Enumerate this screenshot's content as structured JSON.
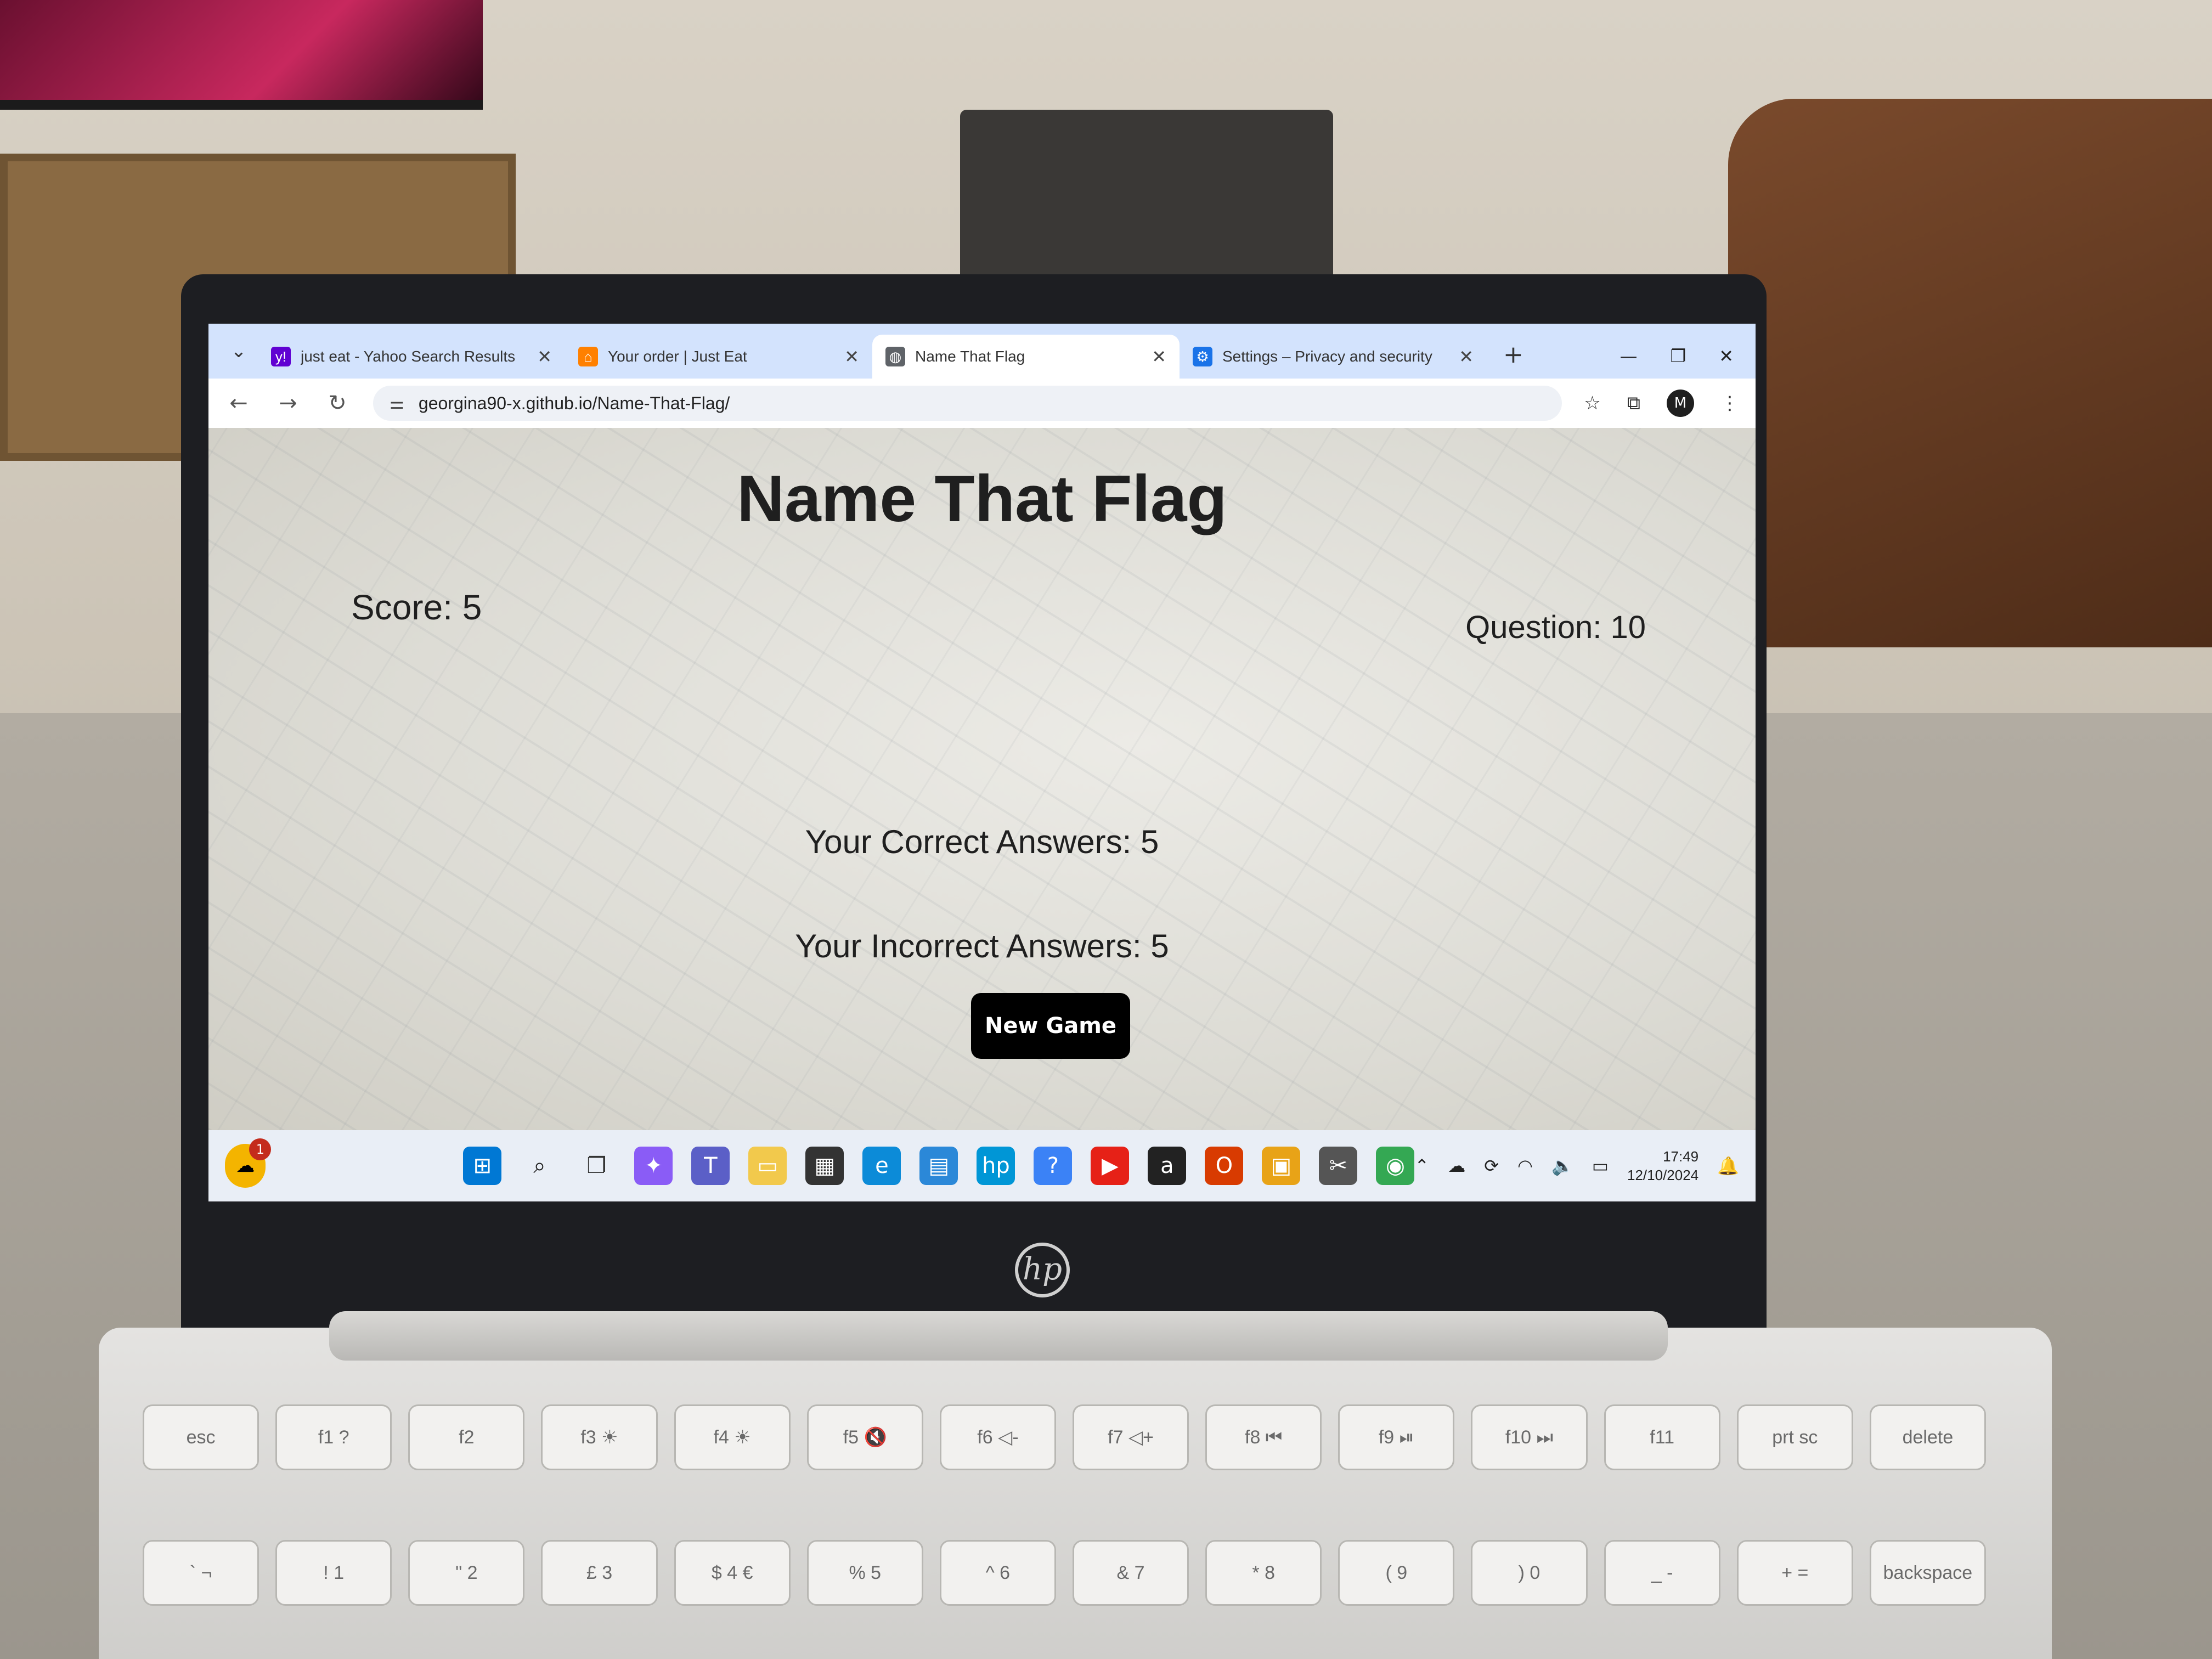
{
  "browser": {
    "tabs": [
      {
        "label": "just eat - Yahoo Search Results",
        "icon": "yahoo-icon",
        "color": "#6001d2",
        "active": false
      },
      {
        "label": "Your order | Just Eat",
        "icon": "just-eat-icon",
        "color": "#ff8000",
        "active": false
      },
      {
        "label": "Name That Flag",
        "icon": "globe-icon",
        "color": "#5f6368",
        "active": true
      },
      {
        "label": "Settings – Privacy and security",
        "icon": "settings-gear-icon",
        "color": "#1a73e8",
        "active": false
      }
    ],
    "url": "georgina90-x.github.io/Name-That-Flag/",
    "profile_initial": "M"
  },
  "page": {
    "title": "Name That Flag",
    "score": "Score: 5",
    "question": "Question: 10",
    "correct": "Your Correct Answers: 5",
    "incorrect": "Your Incorrect Answers: 5",
    "new_game_label": "New Game"
  },
  "taskbar": {
    "weather_badge": "1",
    "time": "17:49",
    "date": "12/10/2024"
  },
  "keyboard": {
    "keys": [
      "esc",
      "f1 ?",
      "f2",
      "f3 ☀",
      "f4 ☀",
      "f5 🔇",
      "f6 ◁-",
      "f7 ◁+",
      "f8 ⏮",
      "f9 ⏯",
      "f10 ⏭",
      "f11",
      "prt sc",
      "delete",
      "` ¬",
      "! 1",
      "\" 2",
      "£ 3",
      "$ 4 €",
      "% 5",
      "^ 6",
      "& 7",
      "* 8",
      "( 9",
      ") 0",
      "_ -",
      "+ =",
      "backspace"
    ]
  },
  "colors": {
    "tab_strip": "#d3e3fd",
    "button_bg": "#000000",
    "button_text": "#ffffff"
  }
}
